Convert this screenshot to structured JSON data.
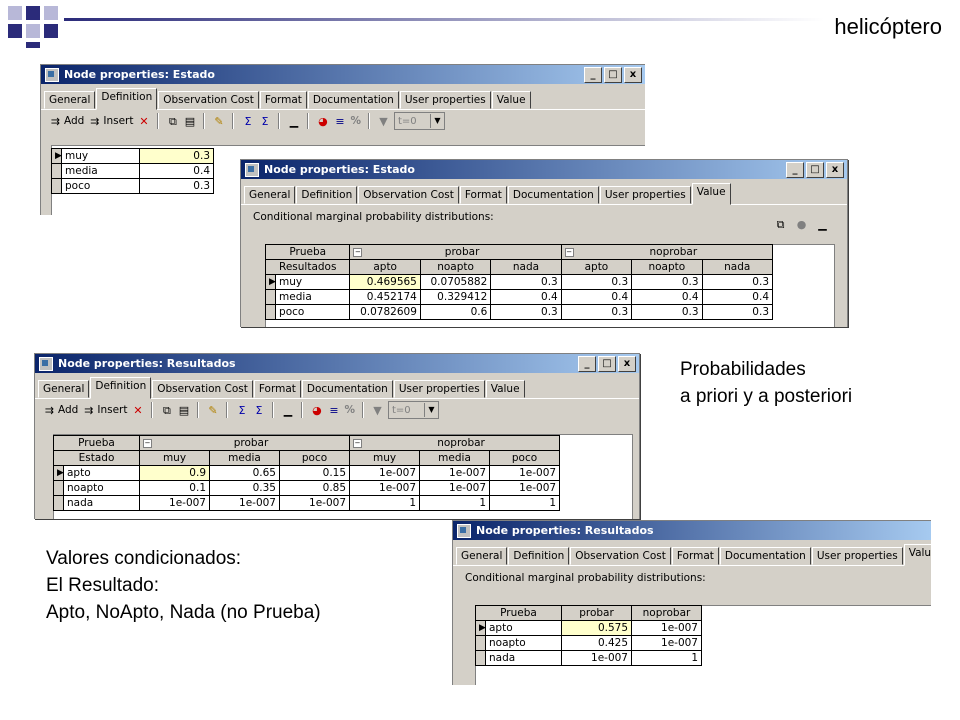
{
  "slide": {
    "title": "helicóptero",
    "caption_right": [
      "Probabilidades",
      "a priori y a posteriori"
    ],
    "caption_left": [
      "Valores condicionados:",
      "El Resultado:",
      "Apto, NoApto, Nada (no Prueba)"
    ],
    "colors": {
      "deco_dark": "#2b2b7a",
      "deco_light": "#b8b8d8",
      "title_bar": "#0a246a",
      "selected_cell": "#ffffcc"
    }
  },
  "window_controls": [
    "_",
    "□",
    "x"
  ],
  "toolbar": {
    "add": "Add",
    "insert": "Insert",
    "percent": "%",
    "time_combo": "t=0"
  },
  "win1": {
    "title": "Node properties: Estado",
    "tabs": [
      "General",
      "Definition",
      "Observation Cost",
      "Format",
      "Documentation",
      "User properties",
      "Value"
    ],
    "active_tab": "Definition",
    "rows": [
      {
        "name": "muy",
        "value": "0.3"
      },
      {
        "name": "media",
        "value": "0.4"
      },
      {
        "name": "poco",
        "value": "0.3"
      }
    ]
  },
  "win2": {
    "title": "Node properties: Estado",
    "tabs": [
      "General",
      "Definition",
      "Observation Cost",
      "Format",
      "Documentation",
      "User properties",
      "Value"
    ],
    "active_tab": "Value",
    "panel_label": "Conditional marginal probability distributions:",
    "header1": {
      "label": "Prueba",
      "groups": [
        "probar",
        "noprobar"
      ]
    },
    "header2": {
      "label": "Resultados",
      "cols": [
        "apto",
        "noapto",
        "nada",
        "apto",
        "noapto",
        "nada"
      ]
    },
    "rows": [
      {
        "name": "muy",
        "values": [
          "0.469565",
          "0.0705882",
          "0.3",
          "0.3",
          "0.3",
          "0.3"
        ]
      },
      {
        "name": "media",
        "values": [
          "0.452174",
          "0.329412",
          "0.4",
          "0.4",
          "0.4",
          "0.4"
        ]
      },
      {
        "name": "poco",
        "values": [
          "0.0782609",
          "0.6",
          "0.3",
          "0.3",
          "0.3",
          "0.3"
        ]
      }
    ]
  },
  "win3": {
    "title": "Node properties: Resultados",
    "tabs": [
      "General",
      "Definition",
      "Observation Cost",
      "Format",
      "Documentation",
      "User properties",
      "Value"
    ],
    "active_tab": "Definition",
    "header1": {
      "label": "Prueba",
      "groups": [
        "probar",
        "noprobar"
      ]
    },
    "header2": {
      "label": "Estado",
      "cols": [
        "muy",
        "media",
        "poco",
        "muy",
        "media",
        "poco"
      ]
    },
    "rows": [
      {
        "name": "apto",
        "values": [
          "0.9",
          "0.65",
          "0.15",
          "1e-007",
          "1e-007",
          "1e-007"
        ]
      },
      {
        "name": "noapto",
        "values": [
          "0.1",
          "0.35",
          "0.85",
          "1e-007",
          "1e-007",
          "1e-007"
        ]
      },
      {
        "name": "nada",
        "values": [
          "1e-007",
          "1e-007",
          "1e-007",
          "1",
          "1",
          "1"
        ]
      }
    ]
  },
  "win4": {
    "title": "Node properties: Resultados",
    "tabs": [
      "General",
      "Definition",
      "Observation Cost",
      "Format",
      "Documentation",
      "User properties",
      "Value"
    ],
    "active_tab": "Value",
    "panel_label": "Conditional marginal probability distributions:",
    "header1": {
      "label": "Prueba",
      "cols": [
        "probar",
        "noprobar"
      ]
    },
    "rows": [
      {
        "name": "apto",
        "values": [
          "0.575",
          "1e-007"
        ]
      },
      {
        "name": "noapto",
        "values": [
          "0.425",
          "1e-007"
        ]
      },
      {
        "name": "nada",
        "values": [
          "1e-007",
          "1"
        ]
      }
    ]
  }
}
